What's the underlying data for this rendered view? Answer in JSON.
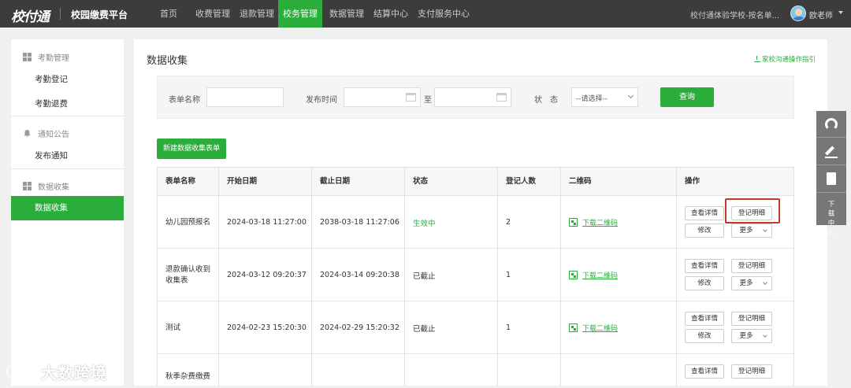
{
  "header": {
    "logo": "校付通",
    "platform": "校园缴费平台",
    "nav": [
      {
        "label": "首页"
      },
      {
        "label": "收费管理"
      },
      {
        "label": "退款管理"
      },
      {
        "label": "校务管理",
        "active": true
      },
      {
        "label": "数据管理"
      },
      {
        "label": "结算中心"
      },
      {
        "label": "支付服务中心"
      }
    ],
    "school": "校付通体验学校-按名单...",
    "user": "欧老师"
  },
  "sidebar": {
    "groups": [
      {
        "label": "考勤管理",
        "items": [
          {
            "label": "考勤登记"
          },
          {
            "label": "考勤退费"
          }
        ]
      },
      {
        "label": "通知公告",
        "items": [
          {
            "label": "发布通知"
          }
        ]
      },
      {
        "label": "数据收集",
        "items": [
          {
            "label": "数据收集",
            "active": true
          }
        ]
      }
    ]
  },
  "main": {
    "title": "数据收集",
    "guide_link": "家校沟通操作指引",
    "filter": {
      "name_label": "表单名称",
      "name_value": "",
      "time_label": "发布时间",
      "to_label": "至",
      "start_value": "",
      "end_value": "",
      "status_label": "状　态",
      "status_value": "--请选择--",
      "query_button": "查询"
    },
    "new_button": "新建数据收集表单",
    "table": {
      "columns": [
        "表单名称",
        "开始日期",
        "截止日期",
        "状态",
        "登记人数",
        "二维码",
        "操作"
      ],
      "rows": [
        {
          "name": "幼儿园预报名",
          "start": "2024-03-18 11:27:00",
          "end": "2038-03-18 11:27:06",
          "status": "生效中",
          "count": "2",
          "qr": "下载二维码"
        },
        {
          "name": "退款确认收到收集表",
          "start": "2024-03-12 09:20:37",
          "end": "2024-03-14 09:20:38",
          "status": "已截止",
          "count": "1",
          "qr": "下载二维码"
        },
        {
          "name": "测试",
          "start": "2024-02-23 15:20:30",
          "end": "2024-02-29 15:20:32",
          "status": "已截止",
          "count": "1",
          "qr": "下载二维码"
        },
        {
          "name": "秋季杂费缴费",
          "start": "",
          "end": "",
          "status": "",
          "count": "",
          "qr": ""
        }
      ],
      "ops": {
        "detail": "查看详情",
        "records": "登记明细",
        "edit": "修改",
        "more": "更多"
      }
    }
  },
  "float_tools": {
    "download": "下载中心"
  },
  "watermark": "大数跨境"
}
